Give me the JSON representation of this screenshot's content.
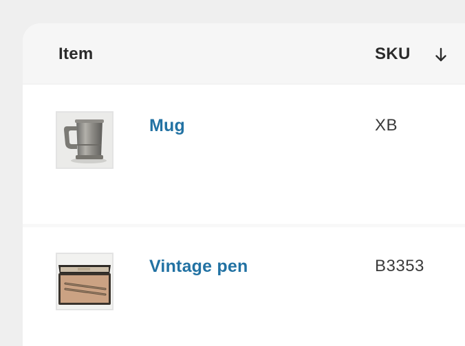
{
  "table": {
    "columns": {
      "item": "Item",
      "sku": "SKU",
      "sort_icon": "arrow-down-icon"
    },
    "rows": [
      {
        "name": "Mug",
        "sku": "XB",
        "thumbnail_icon": "pewter-mug-image"
      },
      {
        "name": "Vintage pen",
        "sku": "B3353",
        "thumbnail_icon": "pen-case-image"
      }
    ]
  },
  "colors": {
    "link": "#2272a3",
    "header_bg": "#f6f6f6",
    "page_bg": "#efefef"
  }
}
